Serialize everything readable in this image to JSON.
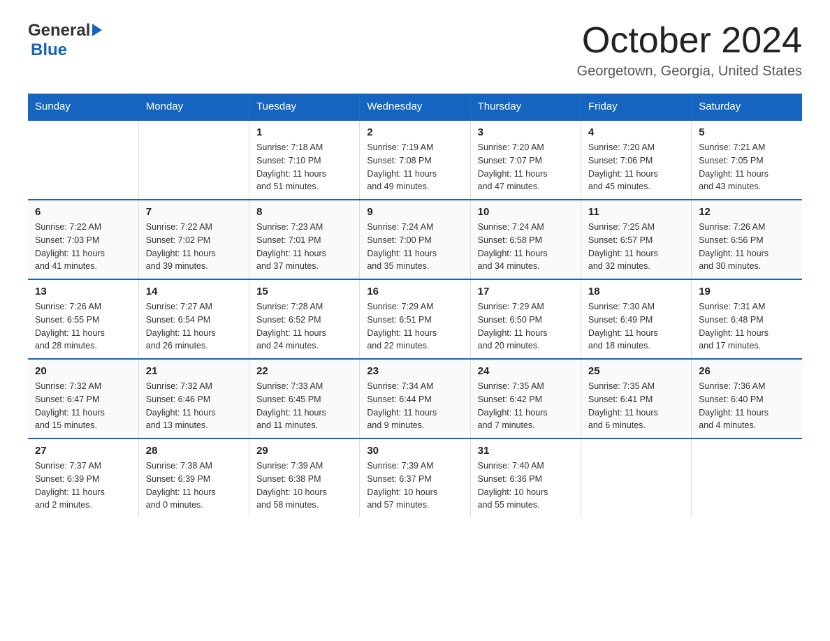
{
  "header": {
    "logo_general": "General",
    "logo_blue": "Blue",
    "title": "October 2024",
    "location": "Georgetown, Georgia, United States"
  },
  "days_of_week": [
    "Sunday",
    "Monday",
    "Tuesday",
    "Wednesday",
    "Thursday",
    "Friday",
    "Saturday"
  ],
  "weeks": [
    [
      {
        "day": "",
        "info": ""
      },
      {
        "day": "",
        "info": ""
      },
      {
        "day": "1",
        "info": "Sunrise: 7:18 AM\nSunset: 7:10 PM\nDaylight: 11 hours\nand 51 minutes."
      },
      {
        "day": "2",
        "info": "Sunrise: 7:19 AM\nSunset: 7:08 PM\nDaylight: 11 hours\nand 49 minutes."
      },
      {
        "day": "3",
        "info": "Sunrise: 7:20 AM\nSunset: 7:07 PM\nDaylight: 11 hours\nand 47 minutes."
      },
      {
        "day": "4",
        "info": "Sunrise: 7:20 AM\nSunset: 7:06 PM\nDaylight: 11 hours\nand 45 minutes."
      },
      {
        "day": "5",
        "info": "Sunrise: 7:21 AM\nSunset: 7:05 PM\nDaylight: 11 hours\nand 43 minutes."
      }
    ],
    [
      {
        "day": "6",
        "info": "Sunrise: 7:22 AM\nSunset: 7:03 PM\nDaylight: 11 hours\nand 41 minutes."
      },
      {
        "day": "7",
        "info": "Sunrise: 7:22 AM\nSunset: 7:02 PM\nDaylight: 11 hours\nand 39 minutes."
      },
      {
        "day": "8",
        "info": "Sunrise: 7:23 AM\nSunset: 7:01 PM\nDaylight: 11 hours\nand 37 minutes."
      },
      {
        "day": "9",
        "info": "Sunrise: 7:24 AM\nSunset: 7:00 PM\nDaylight: 11 hours\nand 35 minutes."
      },
      {
        "day": "10",
        "info": "Sunrise: 7:24 AM\nSunset: 6:58 PM\nDaylight: 11 hours\nand 34 minutes."
      },
      {
        "day": "11",
        "info": "Sunrise: 7:25 AM\nSunset: 6:57 PM\nDaylight: 11 hours\nand 32 minutes."
      },
      {
        "day": "12",
        "info": "Sunrise: 7:26 AM\nSunset: 6:56 PM\nDaylight: 11 hours\nand 30 minutes."
      }
    ],
    [
      {
        "day": "13",
        "info": "Sunrise: 7:26 AM\nSunset: 6:55 PM\nDaylight: 11 hours\nand 28 minutes."
      },
      {
        "day": "14",
        "info": "Sunrise: 7:27 AM\nSunset: 6:54 PM\nDaylight: 11 hours\nand 26 minutes."
      },
      {
        "day": "15",
        "info": "Sunrise: 7:28 AM\nSunset: 6:52 PM\nDaylight: 11 hours\nand 24 minutes."
      },
      {
        "day": "16",
        "info": "Sunrise: 7:29 AM\nSunset: 6:51 PM\nDaylight: 11 hours\nand 22 minutes."
      },
      {
        "day": "17",
        "info": "Sunrise: 7:29 AM\nSunset: 6:50 PM\nDaylight: 11 hours\nand 20 minutes."
      },
      {
        "day": "18",
        "info": "Sunrise: 7:30 AM\nSunset: 6:49 PM\nDaylight: 11 hours\nand 18 minutes."
      },
      {
        "day": "19",
        "info": "Sunrise: 7:31 AM\nSunset: 6:48 PM\nDaylight: 11 hours\nand 17 minutes."
      }
    ],
    [
      {
        "day": "20",
        "info": "Sunrise: 7:32 AM\nSunset: 6:47 PM\nDaylight: 11 hours\nand 15 minutes."
      },
      {
        "day": "21",
        "info": "Sunrise: 7:32 AM\nSunset: 6:46 PM\nDaylight: 11 hours\nand 13 minutes."
      },
      {
        "day": "22",
        "info": "Sunrise: 7:33 AM\nSunset: 6:45 PM\nDaylight: 11 hours\nand 11 minutes."
      },
      {
        "day": "23",
        "info": "Sunrise: 7:34 AM\nSunset: 6:44 PM\nDaylight: 11 hours\nand 9 minutes."
      },
      {
        "day": "24",
        "info": "Sunrise: 7:35 AM\nSunset: 6:42 PM\nDaylight: 11 hours\nand 7 minutes."
      },
      {
        "day": "25",
        "info": "Sunrise: 7:35 AM\nSunset: 6:41 PM\nDaylight: 11 hours\nand 6 minutes."
      },
      {
        "day": "26",
        "info": "Sunrise: 7:36 AM\nSunset: 6:40 PM\nDaylight: 11 hours\nand 4 minutes."
      }
    ],
    [
      {
        "day": "27",
        "info": "Sunrise: 7:37 AM\nSunset: 6:39 PM\nDaylight: 11 hours\nand 2 minutes."
      },
      {
        "day": "28",
        "info": "Sunrise: 7:38 AM\nSunset: 6:39 PM\nDaylight: 11 hours\nand 0 minutes."
      },
      {
        "day": "29",
        "info": "Sunrise: 7:39 AM\nSunset: 6:38 PM\nDaylight: 10 hours\nand 58 minutes."
      },
      {
        "day": "30",
        "info": "Sunrise: 7:39 AM\nSunset: 6:37 PM\nDaylight: 10 hours\nand 57 minutes."
      },
      {
        "day": "31",
        "info": "Sunrise: 7:40 AM\nSunset: 6:36 PM\nDaylight: 10 hours\nand 55 minutes."
      },
      {
        "day": "",
        "info": ""
      },
      {
        "day": "",
        "info": ""
      }
    ]
  ]
}
